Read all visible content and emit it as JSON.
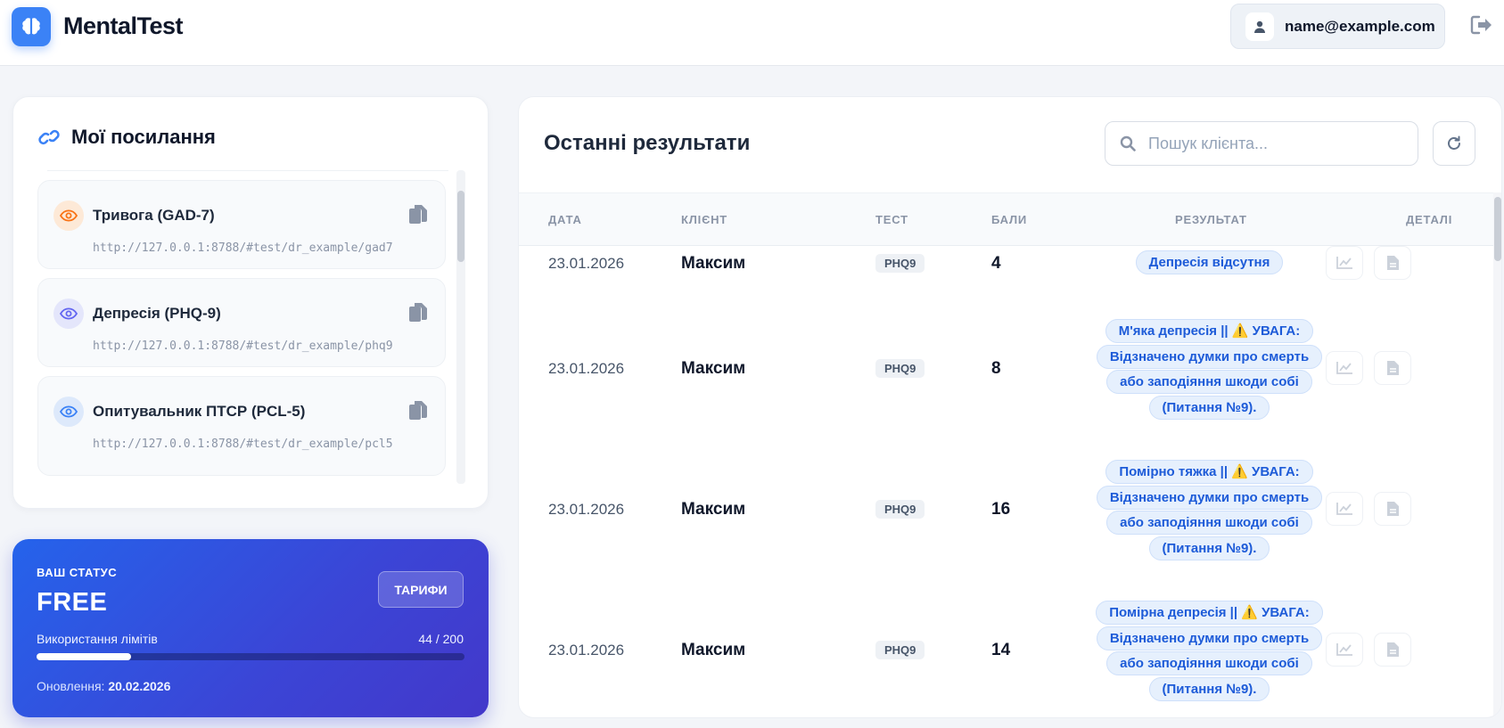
{
  "header": {
    "brand": "MentalTest",
    "user_email": "name@example.com"
  },
  "links": {
    "title": "Мої посилання",
    "items": [
      {
        "name": "Тривога (GAD-7)",
        "url": "http://127.0.0.1:8788/#test/dr_example/gad7",
        "accent": "#f97316"
      },
      {
        "name": "Депресія (PHQ-9)",
        "url": "http://127.0.0.1:8788/#test/dr_example/phq9",
        "accent": "#6366f1"
      },
      {
        "name": "Опитувальник ПТСР (PCL-5)",
        "url": "http://127.0.0.1:8788/#test/dr_example/pcl5",
        "accent": "#3b82f6"
      }
    ]
  },
  "status": {
    "label": "ВАШ СТАТУС",
    "value": "FREE",
    "tariff_button": "ТАРИФИ",
    "usage_label": "Використання лімітів",
    "usage_count": "44 / 200",
    "usage_fraction": 0.22,
    "renew_label": "Оновлення:",
    "renew_date": "20.02.2026"
  },
  "results": {
    "title": "Останні результати",
    "search_placeholder": "Пошук клієнта...",
    "columns": {
      "date": "ДАТА",
      "client": "КЛІЄНТ",
      "test": "ТЕСТ",
      "score": "БАЛИ",
      "result": "РЕЗУЛЬТАТ",
      "details": "ДЕТАЛІ"
    },
    "rows": [
      {
        "date": "23.01.2026",
        "client": "Максим",
        "test": "PHQ9",
        "score": "4",
        "result": "Депресія відсутня"
      },
      {
        "date": "23.01.2026",
        "client": "Максим",
        "test": "PHQ9",
        "score": "8",
        "result": "М'яка депресія || ⚠️ УВАГА: Відзначено думки про смерть або заподіяння шкоди собі (Питання №9)."
      },
      {
        "date": "23.01.2026",
        "client": "Максим",
        "test": "PHQ9",
        "score": "16",
        "result": "Помірно тяжка || ⚠️ УВАГА: Відзначено думки про смерть або заподіяння шкоди собі (Питання №9)."
      },
      {
        "date": "23.01.2026",
        "client": "Максим",
        "test": "PHQ9",
        "score": "14",
        "result": "Помірна депресія || ⚠️ УВАГА: Відзначено думки про смерть або заподіяння шкоди собі (Питання №9)."
      }
    ]
  },
  "colors": {
    "accent": "#3b82f6",
    "result_text": "#1d5bd8"
  }
}
